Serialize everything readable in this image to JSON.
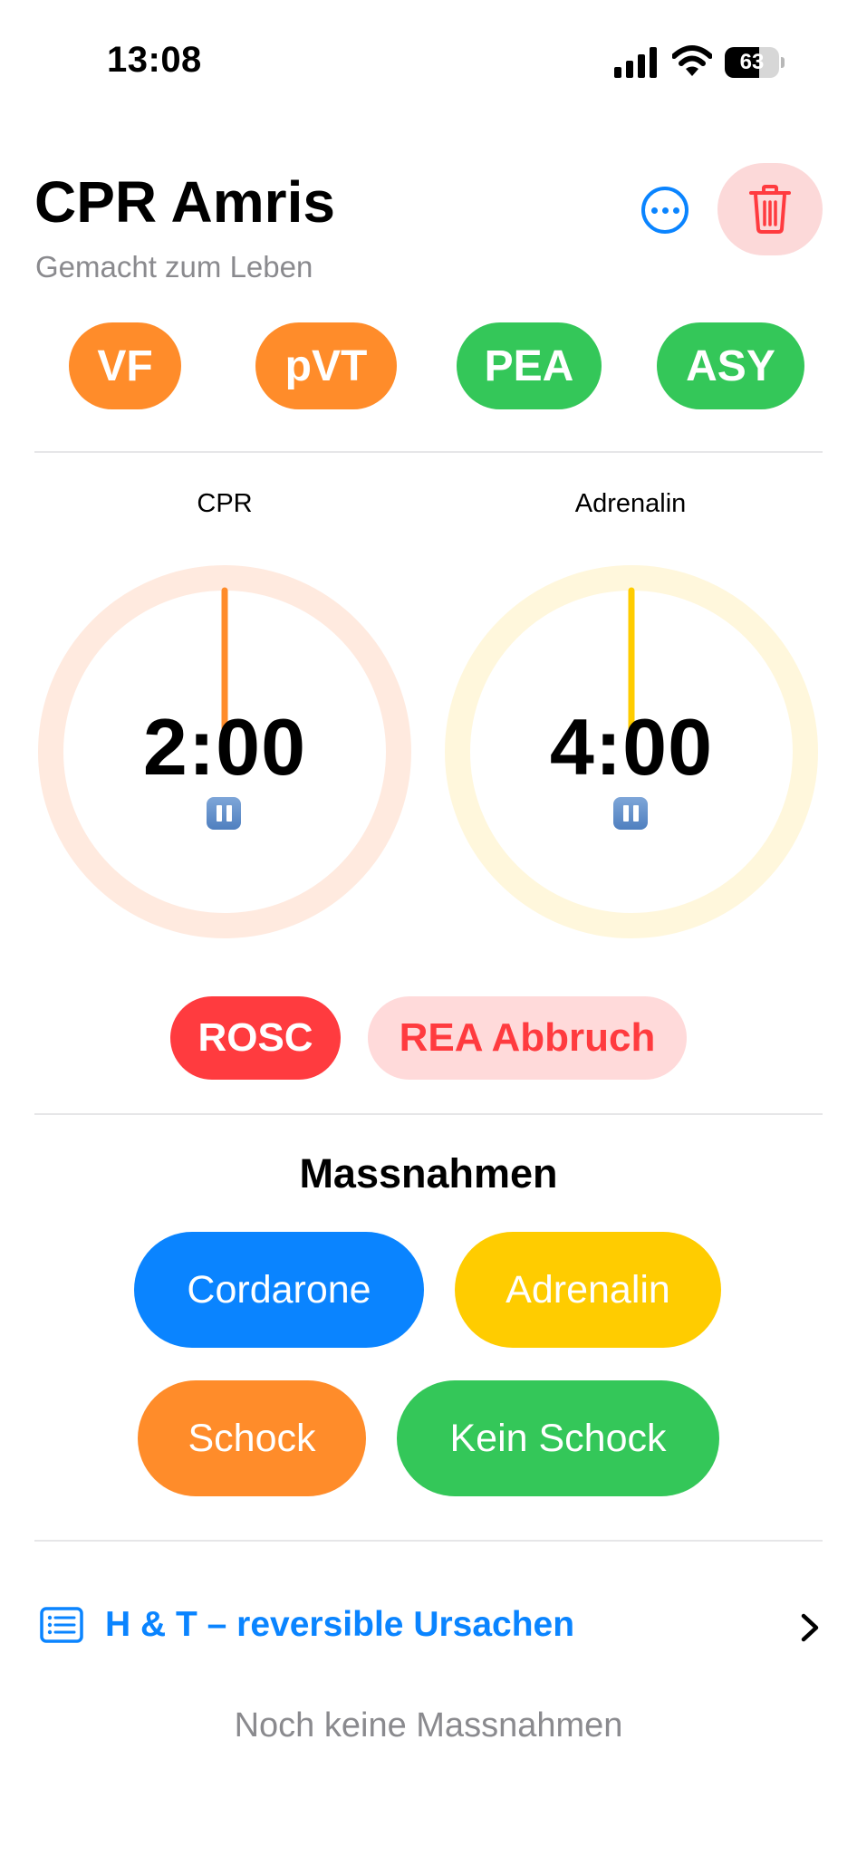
{
  "status_bar": {
    "time": "13:08",
    "battery": "63",
    "battery_level": 0.63
  },
  "header": {
    "title": "CPR Amris",
    "subtitle": "Gemacht zum Leben"
  },
  "rhythms": [
    {
      "label": "VF",
      "color": "#ff8c2a"
    },
    {
      "label": "pVT",
      "color": "#ff8c2a"
    },
    {
      "label": "PEA",
      "color": "#34c759"
    },
    {
      "label": "ASY",
      "color": "#34c759"
    }
  ],
  "timers": [
    {
      "label": "CPR",
      "value": "2:00",
      "ring_color": "#ffeadf",
      "hand_color": "#ff8c2a"
    },
    {
      "label": "Adrenalin",
      "value": "4:00",
      "ring_color": "#fff7dc",
      "hand_color": "#ffcc00"
    }
  ],
  "actions": {
    "rosc": "ROSC",
    "abort": "REA Abbruch"
  },
  "massnahmen": {
    "title": "Massnahmen",
    "cordarone": "Cordarone",
    "adrenalin": "Adrenalin",
    "schock": "Schock",
    "kein_schock": "Kein Schock"
  },
  "causes_link": "H & T – reversible Ursachen",
  "empty_state": "Noch keine Massnahmen",
  "colors": {
    "accent": "#0a84ff",
    "red": "#ff3b3f",
    "orange": "#ff8c2a",
    "green": "#34c759",
    "yellow": "#ffcc00"
  }
}
